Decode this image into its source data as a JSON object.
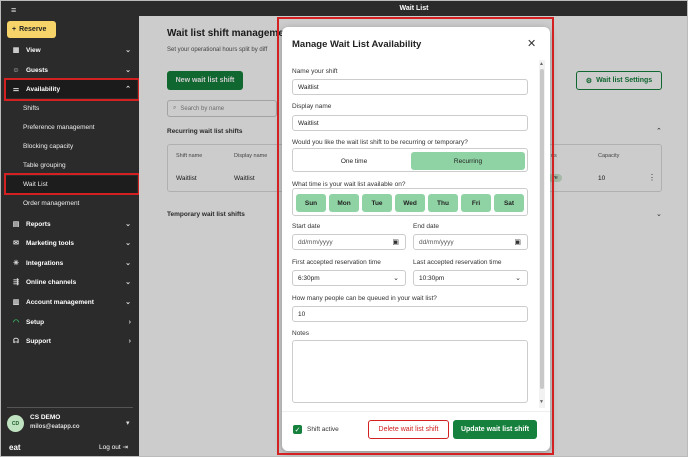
{
  "topbar": {
    "title": "Wait List"
  },
  "sidebar": {
    "reserve_label": "Reserve",
    "items": [
      {
        "label": "View"
      },
      {
        "label": "Guests"
      },
      {
        "label": "Availability"
      },
      {
        "label": "Reports"
      },
      {
        "label": "Marketing tools"
      },
      {
        "label": "Integrations"
      },
      {
        "label": "Online channels"
      },
      {
        "label": "Account management"
      },
      {
        "label": "Setup"
      },
      {
        "label": "Support"
      }
    ],
    "availability_sub": [
      {
        "label": "Shifts"
      },
      {
        "label": "Preference management"
      },
      {
        "label": "Blocking capacity"
      },
      {
        "label": "Table grouping"
      },
      {
        "label": "Wait List"
      },
      {
        "label": "Order management"
      }
    ],
    "user": {
      "initials": "CD",
      "name": "CS DEMO",
      "email": "milos@eatapp.co"
    },
    "logo": "eat",
    "logout_label": "Log out"
  },
  "main": {
    "title": "Wait list shift management",
    "subtitle": "Set your operational hours split by diff",
    "new_button": "New wait list shift",
    "settings_button": "Wait list Settings",
    "search_placeholder": "Search by name",
    "recurring_title": "Recurring wait list shifts",
    "temporary_title": "Temporary wait list shifts",
    "table": {
      "headers": [
        "Shift name",
        "Display name",
        "us",
        "Capacity"
      ],
      "row": {
        "shift_name": "Waitlist",
        "display_name": "Waitlist",
        "status": "ve",
        "capacity": "10"
      }
    }
  },
  "modal": {
    "title": "Manage Wait List Availability",
    "name_label": "Name your shift",
    "name_value": "Waitlist",
    "display_label": "Display name",
    "display_value": "Waitlist",
    "recurring_question": "Would you like the wait list shift to be recurring or temporary?",
    "option_one_time": "One time",
    "option_recurring": "Recurring",
    "days_question": "What time is your wait list available on?",
    "days": [
      "Sun",
      "Mon",
      "Tue",
      "Wed",
      "Thu",
      "Fri",
      "Sat"
    ],
    "start_date_label": "Start date",
    "start_date_placeholder": "dd/mm/yyyy",
    "end_date_label": "End date",
    "end_date_placeholder": "dd/mm/yyyy",
    "first_res_label": "First accepted reservation time",
    "first_res_value": "6:30pm",
    "last_res_label": "Last accepted reservation time",
    "last_res_value": "10:30pm",
    "queue_label": "How many people can be queued in your wait list?",
    "queue_value": "10",
    "notes_label": "Notes",
    "shift_active_label": "Shift active",
    "delete_button": "Delete wait list shift",
    "update_button": "Update wait list shift"
  },
  "colors": {
    "accent_green": "#16813d",
    "selected_green": "#8fd3a4",
    "highlight_red": "#d32020",
    "sidebar_bg": "#2b2b2b",
    "reserve_yellow": "#f6d46a"
  }
}
